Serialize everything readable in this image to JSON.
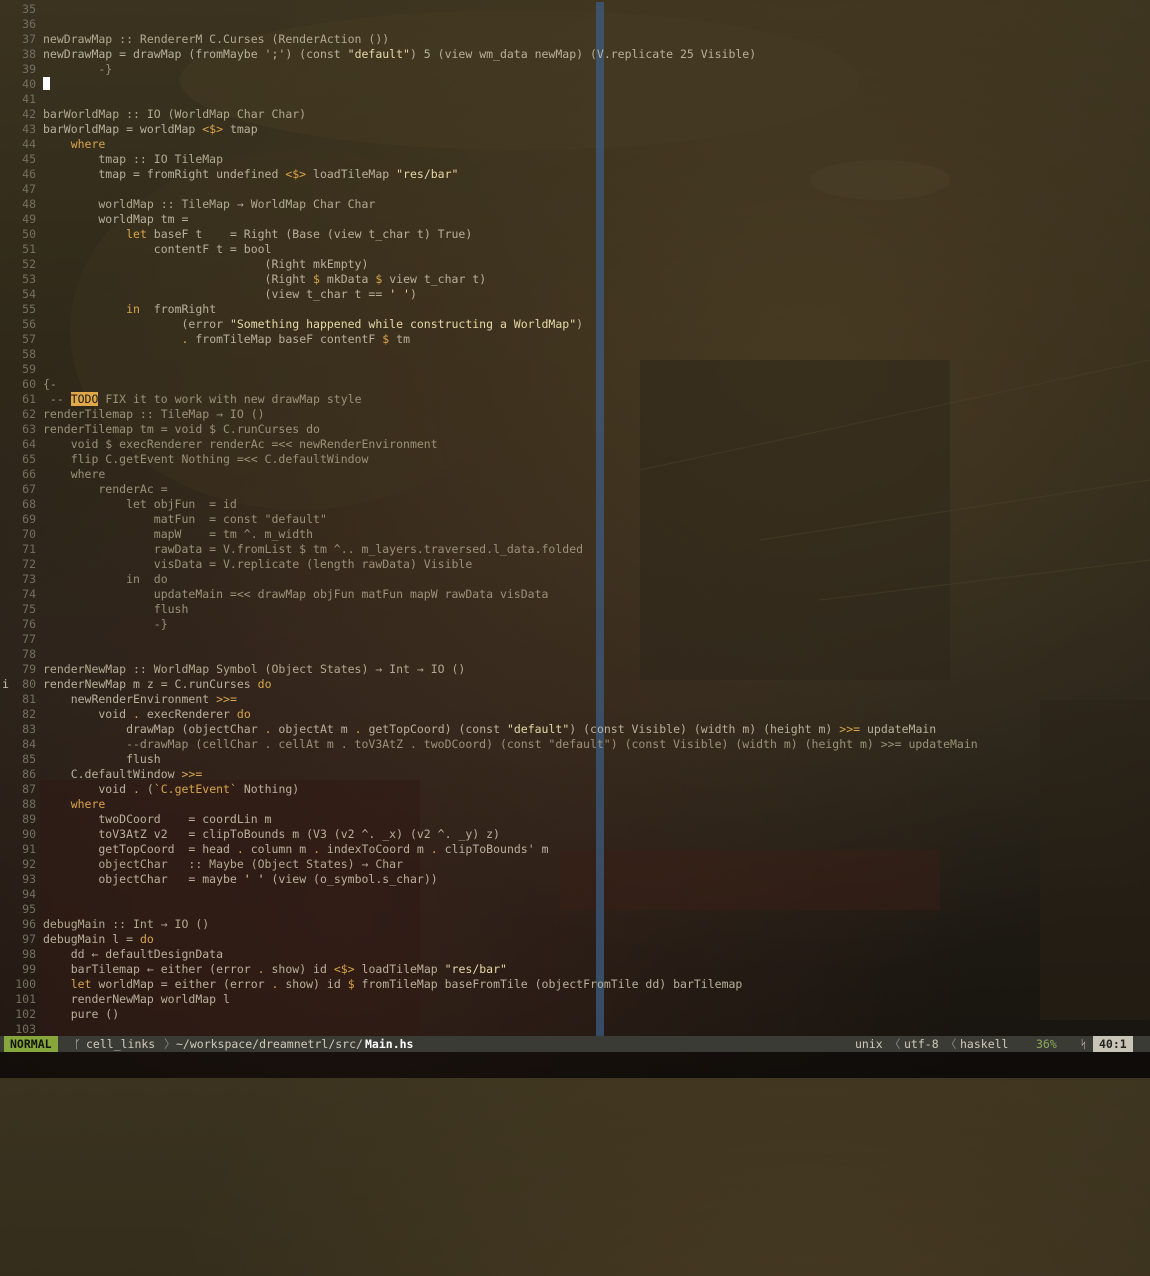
{
  "editor": {
    "lines": [
      {
        "n": "35",
        "segs": []
      },
      {
        "n": "36",
        "segs": []
      },
      {
        "n": "37",
        "segs": [
          {
            "t": "newDrawMap :: RendererM C.Curses (RenderAction ())",
            "c": "t"
          }
        ]
      },
      {
        "n": "38",
        "segs": [
          {
            "t": "newDrawMap = drawMap (fromMaybe ';') (const ",
            "c": ""
          },
          {
            "t": "\"default\"",
            "c": "s"
          },
          {
            "t": ") 5 (view wm_data newMap) (V.replicate 25 Visible)",
            "c": ""
          }
        ]
      },
      {
        "n": "39",
        "segs": [
          {
            "t": "        -}",
            "c": "c"
          }
        ]
      },
      {
        "n": "40",
        "segs": [],
        "cursor": true
      },
      {
        "n": "41",
        "segs": []
      },
      {
        "n": "42",
        "segs": [
          {
            "t": "barWorldMap :: IO (WorldMap Char Char)",
            "c": "t"
          }
        ]
      },
      {
        "n": "43",
        "segs": [
          {
            "t": "barWorldMap = worldMap ",
            "c": ""
          },
          {
            "t": "<$>",
            "c": "k"
          },
          {
            "t": " tmap",
            "c": ""
          }
        ]
      },
      {
        "n": "44",
        "segs": [
          {
            "t": "    ",
            "c": ""
          },
          {
            "t": "where",
            "c": "k"
          }
        ]
      },
      {
        "n": "45",
        "segs": [
          {
            "t": "        tmap :: IO TileMap",
            "c": "t"
          }
        ]
      },
      {
        "n": "46",
        "segs": [
          {
            "t": "        tmap = fromRight undefined ",
            "c": ""
          },
          {
            "t": "<$>",
            "c": "k"
          },
          {
            "t": " loadTileMap ",
            "c": ""
          },
          {
            "t": "\"res/bar\"",
            "c": "s"
          }
        ]
      },
      {
        "n": "47",
        "segs": []
      },
      {
        "n": "48",
        "segs": [
          {
            "t": "        worldMap :: TileMap → WorldMap Char Char",
            "c": "t"
          }
        ]
      },
      {
        "n": "49",
        "segs": [
          {
            "t": "        worldMap tm =",
            "c": ""
          }
        ]
      },
      {
        "n": "50",
        "segs": [
          {
            "t": "            ",
            "c": ""
          },
          {
            "t": "let",
            "c": "k"
          },
          {
            "t": " baseF t    = Right (Base (view t_char t) True)",
            "c": ""
          }
        ]
      },
      {
        "n": "51",
        "segs": [
          {
            "t": "                contentF t = bool",
            "c": ""
          }
        ]
      },
      {
        "n": "52",
        "segs": [
          {
            "t": "                                (Right mkEmpty)",
            "c": ""
          }
        ]
      },
      {
        "n": "53",
        "segs": [
          {
            "t": "                                (Right ",
            "c": ""
          },
          {
            "t": "$",
            "c": "k"
          },
          {
            "t": " mkData ",
            "c": ""
          },
          {
            "t": "$",
            "c": "k"
          },
          {
            "t": " view t_char t)",
            "c": ""
          }
        ]
      },
      {
        "n": "54",
        "segs": [
          {
            "t": "                                (view t_char t == ",
            "c": ""
          },
          {
            "t": "' '",
            "c": "s"
          },
          {
            "t": ")",
            "c": ""
          }
        ]
      },
      {
        "n": "55",
        "segs": [
          {
            "t": "            ",
            "c": ""
          },
          {
            "t": "in",
            "c": "k"
          },
          {
            "t": "  fromRight",
            "c": ""
          }
        ]
      },
      {
        "n": "56",
        "segs": [
          {
            "t": "                    (error ",
            "c": ""
          },
          {
            "t": "\"Something happened while constructing a WorldMap\"",
            "c": "s"
          },
          {
            "t": ")",
            "c": ""
          }
        ]
      },
      {
        "n": "57",
        "segs": [
          {
            "t": "                    ",
            "c": ""
          },
          {
            "t": ".",
            "c": "k"
          },
          {
            "t": " fromTileMap baseF contentF ",
            "c": ""
          },
          {
            "t": "$",
            "c": "k"
          },
          {
            "t": " tm",
            "c": ""
          }
        ]
      },
      {
        "n": "58",
        "segs": []
      },
      {
        "n": "59",
        "segs": []
      },
      {
        "n": "60",
        "segs": [
          {
            "t": "{-",
            "c": "c"
          }
        ]
      },
      {
        "n": "61",
        "segs": [
          {
            "t": " -- ",
            "c": "c"
          },
          {
            "t": "TODO",
            "c": "todo"
          },
          {
            "t": " FIX it to work with new drawMap style",
            "c": "c"
          }
        ]
      },
      {
        "n": "62",
        "segs": [
          {
            "t": "renderTilemap :: TileMap → IO ()",
            "c": "c"
          }
        ]
      },
      {
        "n": "63",
        "segs": [
          {
            "t": "renderTilemap tm = void $ C.runCurses do",
            "c": "c"
          }
        ]
      },
      {
        "n": "64",
        "segs": [
          {
            "t": "    void $ execRenderer renderAc =<< newRenderEnvironment",
            "c": "c"
          }
        ]
      },
      {
        "n": "65",
        "segs": [
          {
            "t": "    flip C.getEvent Nothing =<< C.defaultWindow",
            "c": "c"
          }
        ]
      },
      {
        "n": "66",
        "segs": [
          {
            "t": "    where",
            "c": "c"
          }
        ]
      },
      {
        "n": "67",
        "segs": [
          {
            "t": "        renderAc =",
            "c": "c"
          }
        ]
      },
      {
        "n": "68",
        "segs": [
          {
            "t": "            let objFun  = id",
            "c": "c"
          }
        ]
      },
      {
        "n": "69",
        "segs": [
          {
            "t": "                matFun  = const \"default\"",
            "c": "c"
          }
        ]
      },
      {
        "n": "70",
        "segs": [
          {
            "t": "                mapW    = tm ^. m_width",
            "c": "c"
          }
        ]
      },
      {
        "n": "71",
        "segs": [
          {
            "t": "                rawData = V.fromList $ tm ^.. m_layers.traversed.l_data.folded",
            "c": "c"
          }
        ]
      },
      {
        "n": "72",
        "segs": [
          {
            "t": "                visData = V.replicate (length rawData) Visible",
            "c": "c"
          }
        ]
      },
      {
        "n": "73",
        "segs": [
          {
            "t": "            in  do",
            "c": "c"
          }
        ]
      },
      {
        "n": "74",
        "segs": [
          {
            "t": "                updateMain =<< drawMap objFun matFun mapW rawData visData",
            "c": "c"
          }
        ]
      },
      {
        "n": "75",
        "segs": [
          {
            "t": "                flush",
            "c": "c"
          }
        ]
      },
      {
        "n": "76",
        "segs": [
          {
            "t": "                -}",
            "c": "c"
          }
        ]
      },
      {
        "n": "77",
        "segs": []
      },
      {
        "n": "78",
        "segs": []
      },
      {
        "n": "79",
        "segs": [
          {
            "t": "renderNewMap :: WorldMap Symbol (Object States) → Int → IO ()",
            "c": "t"
          }
        ]
      },
      {
        "n": "80",
        "segs": [
          {
            "t": "renderNewMap m z = C.runCurses ",
            "c": ""
          },
          {
            "t": "do",
            "c": "k"
          }
        ],
        "sign": "i"
      },
      {
        "n": "81",
        "segs": [
          {
            "t": "    newRenderEnvironment ",
            "c": ""
          },
          {
            "t": ">>=",
            "c": "k"
          }
        ]
      },
      {
        "n": "82",
        "segs": [
          {
            "t": "        void ",
            "c": ""
          },
          {
            "t": ".",
            "c": "k"
          },
          {
            "t": " execRenderer ",
            "c": ""
          },
          {
            "t": "do",
            "c": "k"
          }
        ]
      },
      {
        "n": "83",
        "segs": [
          {
            "t": "            drawMap (objectChar ",
            "c": ""
          },
          {
            "t": ".",
            "c": "k"
          },
          {
            "t": " objectAt m ",
            "c": ""
          },
          {
            "t": ".",
            "c": "k"
          },
          {
            "t": " getTopCoord) (const ",
            "c": ""
          },
          {
            "t": "\"default\"",
            "c": "s"
          },
          {
            "t": ") (const Visible) (width m) (height m) ",
            "c": ""
          },
          {
            "t": ">>=",
            "c": "k"
          },
          {
            "t": " updateMain",
            "c": ""
          }
        ]
      },
      {
        "n": "84",
        "segs": [
          {
            "t": "            --drawMap (cellChar . cellAt m . toV3AtZ . twoDCoord) (const \"default\") (const Visible) (width m) (height m) >>= updateMain",
            "c": "c"
          }
        ]
      },
      {
        "n": "85",
        "segs": [
          {
            "t": "            flush",
            "c": ""
          }
        ]
      },
      {
        "n": "86",
        "segs": [
          {
            "t": "    C.defaultWindow ",
            "c": ""
          },
          {
            "t": ">>=",
            "c": "k"
          }
        ]
      },
      {
        "n": "87",
        "segs": [
          {
            "t": "        void ",
            "c": ""
          },
          {
            "t": ".",
            "c": "k"
          },
          {
            "t": " (",
            "c": ""
          },
          {
            "t": "`C.getEvent`",
            "c": "k"
          },
          {
            "t": " Nothing)",
            "c": ""
          }
        ]
      },
      {
        "n": "88",
        "segs": [
          {
            "t": "    ",
            "c": ""
          },
          {
            "t": "where",
            "c": "k"
          }
        ]
      },
      {
        "n": "89",
        "segs": [
          {
            "t": "        twoDCoord    = coordLin m",
            "c": ""
          }
        ]
      },
      {
        "n": "90",
        "segs": [
          {
            "t": "        toV3AtZ v2   = clipToBounds m (V3 (v2 ^. _x) (v2 ^. _y) z)",
            "c": ""
          }
        ]
      },
      {
        "n": "91",
        "segs": [
          {
            "t": "        getTopCoord  = head ",
            "c": ""
          },
          {
            "t": ".",
            "c": "k"
          },
          {
            "t": " column m ",
            "c": ""
          },
          {
            "t": ".",
            "c": "k"
          },
          {
            "t": " indexToCoord m ",
            "c": ""
          },
          {
            "t": ".",
            "c": "k"
          },
          {
            "t": " clipToBounds' m",
            "c": ""
          }
        ]
      },
      {
        "n": "92",
        "segs": [
          {
            "t": "        objectChar   :: Maybe (Object States) → Char",
            "c": "t"
          }
        ]
      },
      {
        "n": "93",
        "segs": [
          {
            "t": "        objectChar   = maybe ",
            "c": ""
          },
          {
            "t": "' '",
            "c": "s"
          },
          {
            "t": " (view (o_symbol.s_char))",
            "c": ""
          }
        ]
      },
      {
        "n": "94",
        "segs": []
      },
      {
        "n": "95",
        "segs": []
      },
      {
        "n": "96",
        "segs": [
          {
            "t": "debugMain :: Int → IO ()",
            "c": "t"
          }
        ]
      },
      {
        "n": "97",
        "segs": [
          {
            "t": "debugMain l = ",
            "c": ""
          },
          {
            "t": "do",
            "c": "k"
          }
        ]
      },
      {
        "n": "98",
        "segs": [
          {
            "t": "    dd ← defaultDesignData",
            "c": ""
          }
        ]
      },
      {
        "n": "99",
        "segs": [
          {
            "t": "    barTilemap ← either (error ",
            "c": ""
          },
          {
            "t": ".",
            "c": "k"
          },
          {
            "t": " show) id ",
            "c": ""
          },
          {
            "t": "<$>",
            "c": "k"
          },
          {
            "t": " loadTileMap ",
            "c": ""
          },
          {
            "t": "\"res/bar\"",
            "c": "s"
          }
        ]
      },
      {
        "n": "100",
        "segs": [
          {
            "t": "    ",
            "c": ""
          },
          {
            "t": "let",
            "c": "k"
          },
          {
            "t": " worldMap = either (error ",
            "c": ""
          },
          {
            "t": ".",
            "c": "k"
          },
          {
            "t": " show) id ",
            "c": ""
          },
          {
            "t": "$",
            "c": "k"
          },
          {
            "t": " fromTileMap baseFromTile (objectFromTile dd) barTilemap",
            "c": ""
          }
        ]
      },
      {
        "n": "101",
        "segs": [
          {
            "t": "    renderNewMap worldMap l",
            "c": ""
          }
        ]
      },
      {
        "n": "102",
        "segs": [
          {
            "t": "    pure ()",
            "c": ""
          }
        ]
      },
      {
        "n": "103",
        "segs": []
      }
    ]
  },
  "statusbar": {
    "mode": "NORMAL",
    "branch_icon": "ᚴ",
    "branch": "cell_links",
    "sep1": "〉",
    "path": "~/workspace/dreamnetrl/src/",
    "file": "Main.hs",
    "fileformat": "unix",
    "sep2": "〈",
    "encoding": "utf-8",
    "sep3": "〈",
    "filetype": "haskell",
    "percent": "36%",
    "line_icon": "ᛋ",
    "position": "40:1"
  },
  "colors": {
    "keyword": "#d8a54a",
    "string": "#e7d9a6",
    "comment": "#9a9277",
    "mode_bg": "#86a73b",
    "color_column": "#3c5c80"
  }
}
